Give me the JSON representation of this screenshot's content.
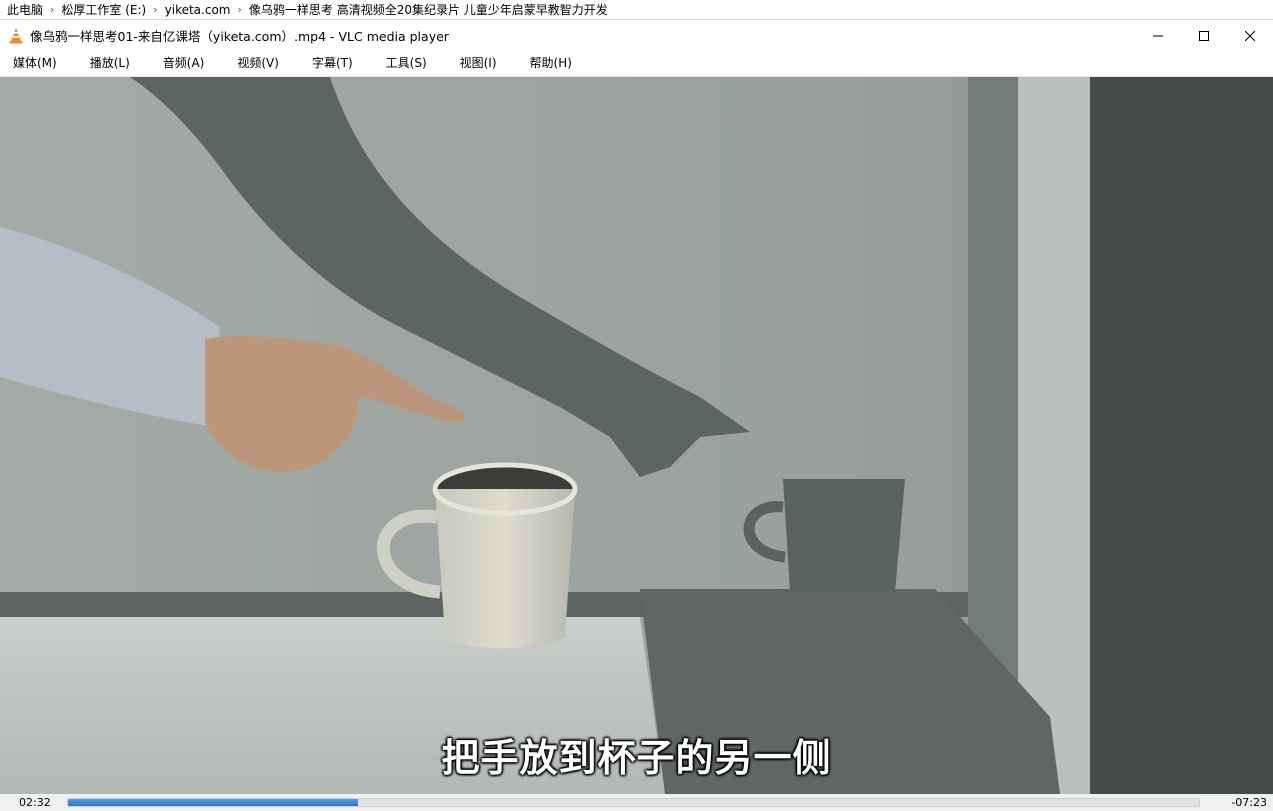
{
  "breadcrumb": {
    "items": [
      "此电脑",
      "松厚工作室 (E:)",
      "yiketa.com",
      "像乌鸦一样思考 高清视频全20集纪录片 儿童少年启蒙早教智力开发"
    ]
  },
  "window": {
    "title": "像乌鸦一样思考01-来自亿课塔（yiketa.com）.mp4 - VLC media player",
    "icon": "vlc-cone-icon",
    "controls": [
      "minimize-icon",
      "maximize-icon",
      "close-icon"
    ]
  },
  "menu": {
    "items": [
      "媒体(M)",
      "播放(L)",
      "音频(A)",
      "视频(V)",
      "字幕(T)",
      "工具(S)",
      "视图(I)",
      "帮助(H)"
    ]
  },
  "video": {
    "subtitle": "把手放到杯子的另一侧"
  },
  "playback": {
    "elapsed": "02:32",
    "remaining": "-07:23",
    "progress_fraction": 0.256
  },
  "colors": {
    "accent": "#2a78cf",
    "vlc_orange": "#f08c1e"
  }
}
